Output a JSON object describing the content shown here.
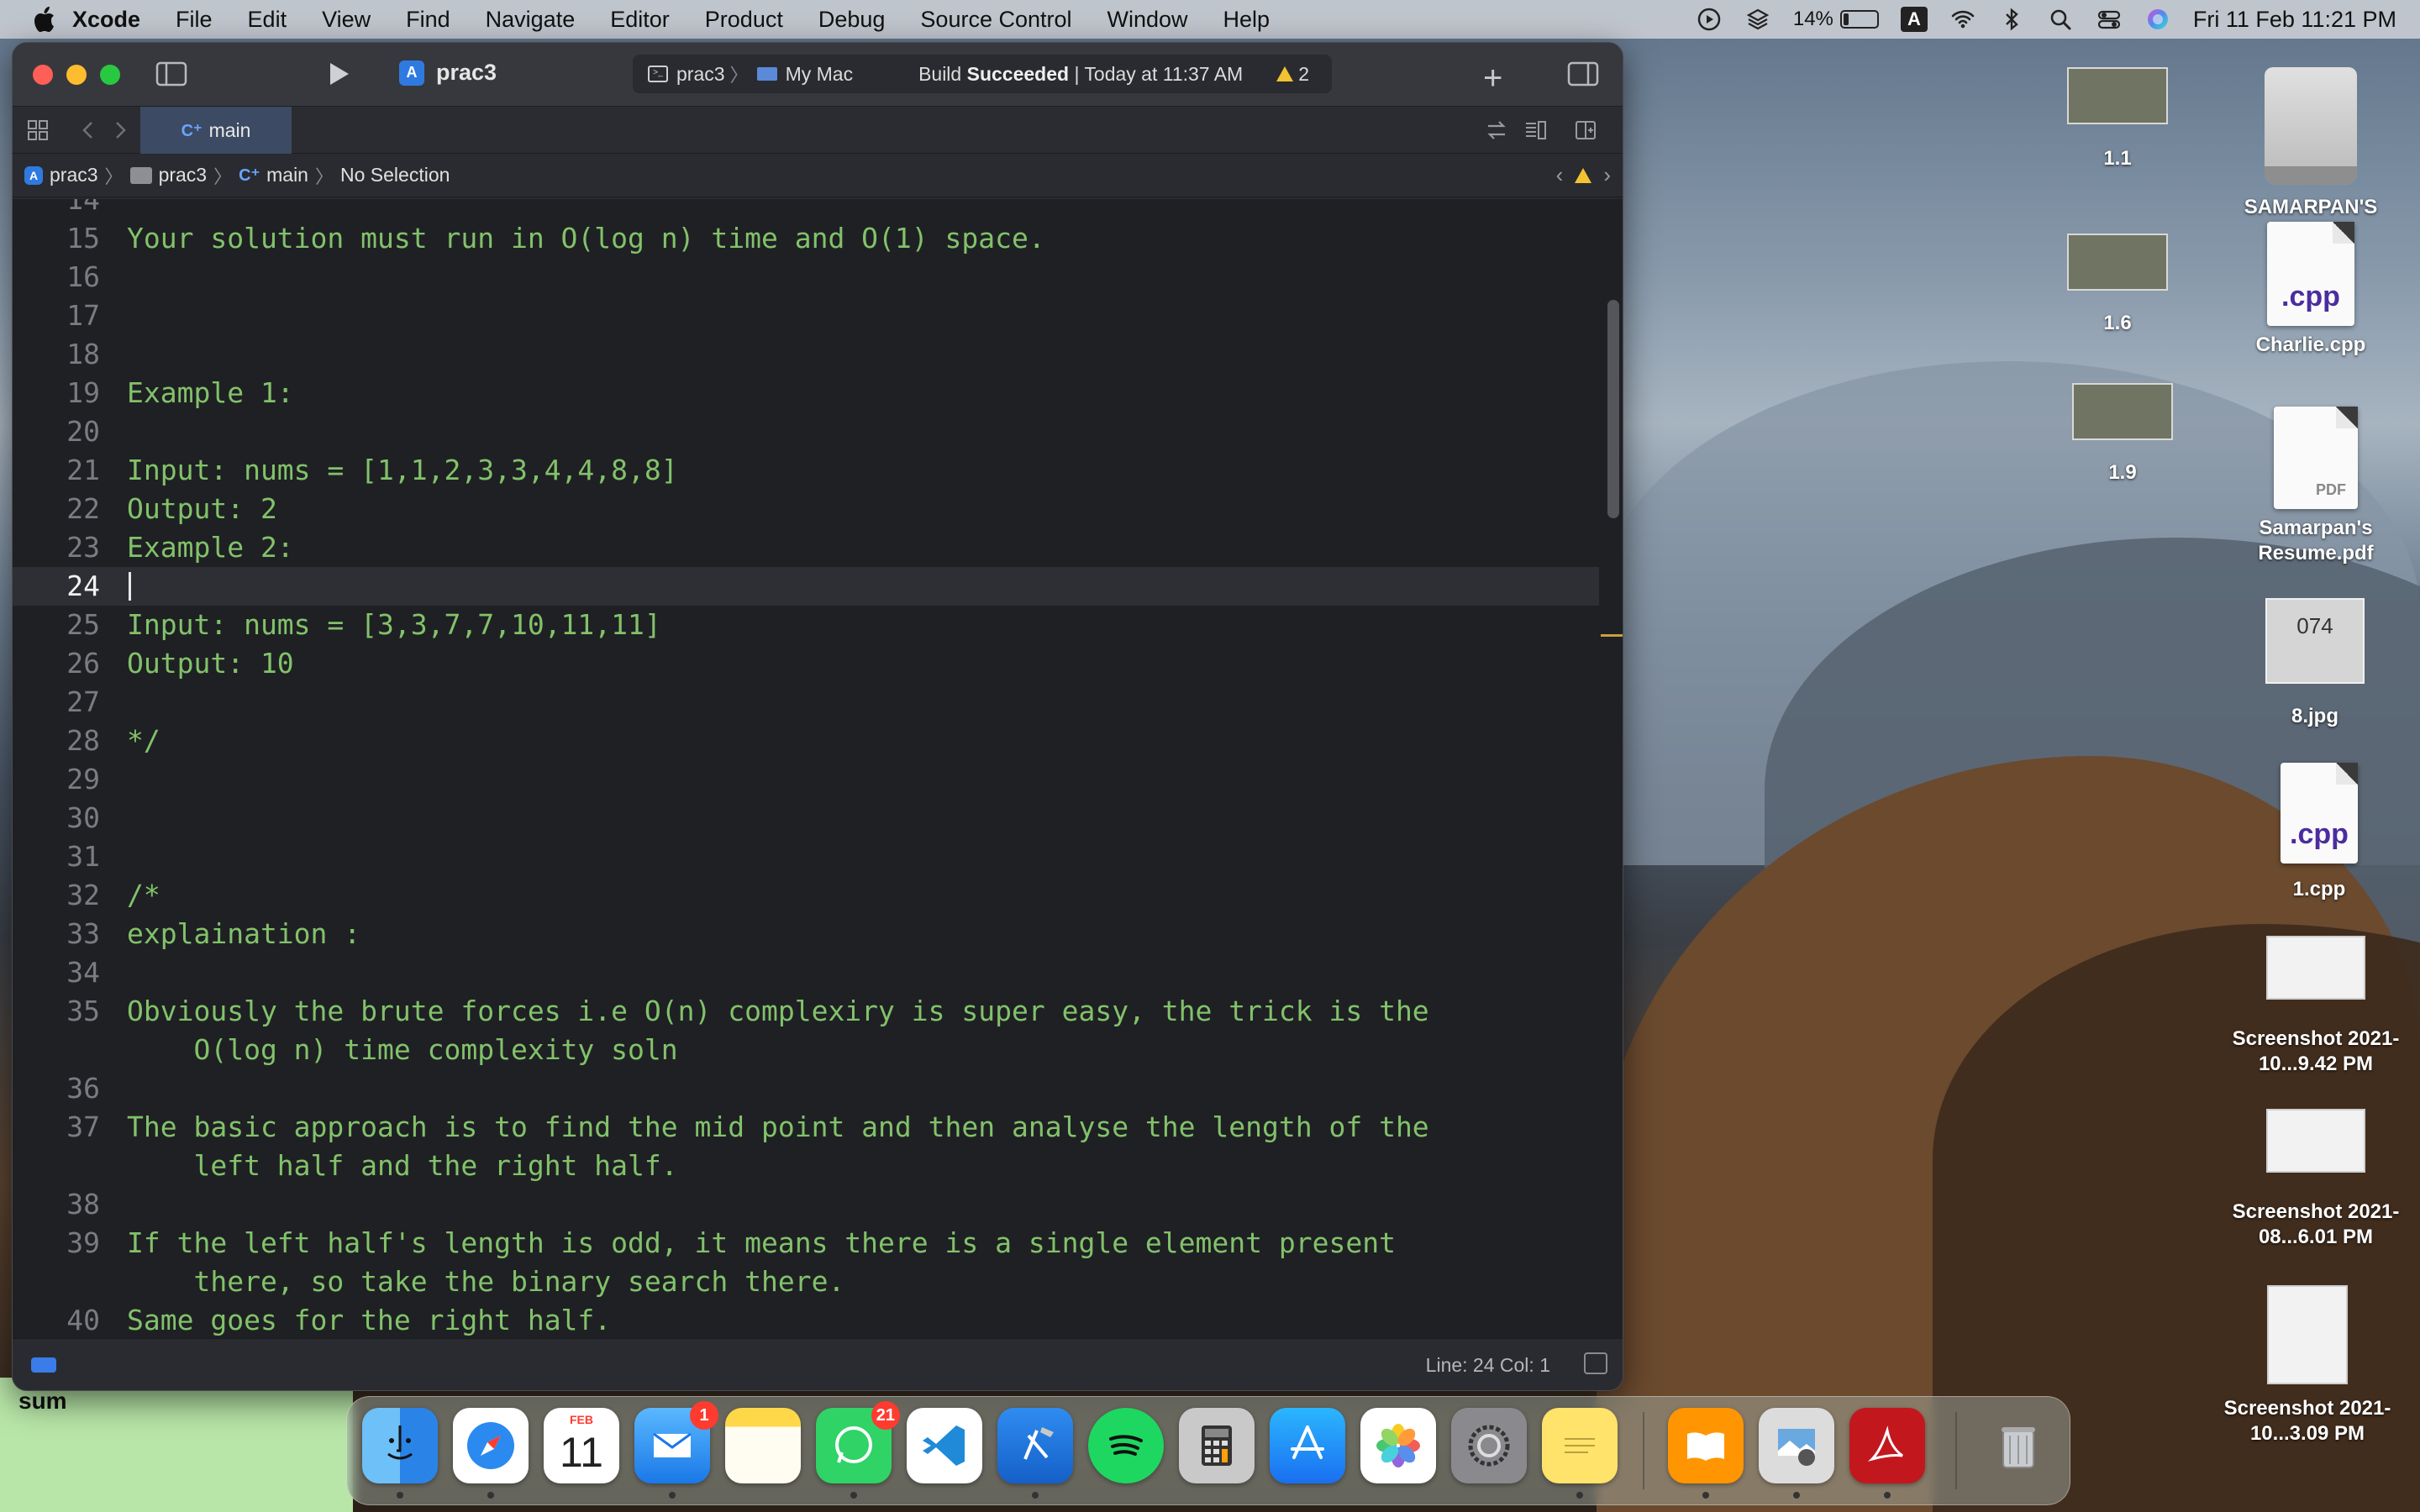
{
  "menubar": {
    "app_name": "Xcode",
    "items": [
      "File",
      "Edit",
      "View",
      "Find",
      "Navigate",
      "Editor",
      "Product",
      "Debug",
      "Source Control",
      "Window",
      "Help"
    ],
    "battery": "14%",
    "input_source": "A",
    "clock": "Fri 11 Feb  11:21 PM"
  },
  "window": {
    "project": "prac3",
    "scheme": "prac3",
    "destination": "My Mac",
    "build_status_prefix": "Build ",
    "build_status_word": "Succeeded",
    "build_status_time": " | Today at 11:37 AM",
    "warnings": "2",
    "tab": "main",
    "breadcrumb": [
      "prac3",
      "prac3",
      "main",
      "No Selection"
    ],
    "status_line": "Line: 24  Col: 1"
  },
  "code_lines": [
    {
      "n": "14",
      "t": ""
    },
    {
      "n": "15",
      "t": "Your solution must run in O(log n) time and O(1) space."
    },
    {
      "n": "16",
      "t": ""
    },
    {
      "n": "17",
      "t": ""
    },
    {
      "n": "18",
      "t": ""
    },
    {
      "n": "19",
      "t": "Example 1:"
    },
    {
      "n": "20",
      "t": ""
    },
    {
      "n": "21",
      "t": "Input: nums = [1,1,2,3,3,4,4,8,8]"
    },
    {
      "n": "22",
      "t": "Output: 2"
    },
    {
      "n": "23",
      "t": "Example 2:"
    },
    {
      "n": "24",
      "t": ""
    },
    {
      "n": "25",
      "t": "Input: nums = [3,3,7,7,10,11,11]"
    },
    {
      "n": "26",
      "t": "Output: 10"
    },
    {
      "n": "27",
      "t": ""
    },
    {
      "n": "28",
      "t": "*/"
    },
    {
      "n": "29",
      "t": ""
    },
    {
      "n": "30",
      "t": ""
    },
    {
      "n": "31",
      "t": ""
    },
    {
      "n": "32",
      "t": "/*"
    },
    {
      "n": "33",
      "t": "explaination :"
    },
    {
      "n": "34",
      "t": ""
    },
    {
      "n": "35",
      "t": "Obviously the brute forces i.e O(n) complexiry is super easy, the trick is the"
    },
    {
      "n": "",
      "t": "    O(log n) time complexity soln"
    },
    {
      "n": "36",
      "t": ""
    },
    {
      "n": "37",
      "t": "The basic approach is to find the mid point and then analyse the length of the"
    },
    {
      "n": "",
      "t": "    left half and the right half."
    },
    {
      "n": "38",
      "t": ""
    },
    {
      "n": "39",
      "t": "If the left half's length is odd, it means there is a single element present"
    },
    {
      "n": "",
      "t": "    there, so take the binary search there."
    },
    {
      "n": "40",
      "t": "Same goes for the right half."
    }
  ],
  "desktop": {
    "icons": [
      {
        "label": "1.1"
      },
      {
        "label": "SAMARPAN'S"
      },
      {
        "label": "1.6"
      },
      {
        "label": "Charlie.cpp",
        "badge": ".cpp"
      },
      {
        "label": "1.9"
      },
      {
        "label": "Samarpan's Resume.pdf",
        "badge": "PDF"
      },
      {
        "label": "8.jpg",
        "badge": "074"
      },
      {
        "label": "1.cpp",
        "badge": ".cpp"
      },
      {
        "label": "Screenshot 2021-10...9.42 PM"
      },
      {
        "label": "Screenshot 2021-08...6.01 PM"
      },
      {
        "label": "Screenshot 2021-10...3.09 PM"
      }
    ],
    "partial_window_label": "sum"
  },
  "dock": {
    "apps": [
      {
        "name": "Finder"
      },
      {
        "name": "Safari"
      },
      {
        "name": "Calendar",
        "month": "FEB",
        "day": "11"
      },
      {
        "name": "Mail",
        "badge": "1"
      },
      {
        "name": "Notes"
      },
      {
        "name": "WhatsApp",
        "badge": "21"
      },
      {
        "name": "Visual Studio Code"
      },
      {
        "name": "Xcode"
      },
      {
        "name": "Spotify"
      },
      {
        "name": "Calculator"
      },
      {
        "name": "App Store"
      },
      {
        "name": "Photos"
      },
      {
        "name": "System Preferences"
      },
      {
        "name": "Stickies"
      },
      {
        "name": "Books"
      },
      {
        "name": "Preview"
      },
      {
        "name": "Acrobat"
      },
      {
        "name": "Trash"
      }
    ]
  },
  "colors": {
    "code_text": "#82c26a",
    "editor_bg": "#1f2024",
    "accent": "#3a7ce8"
  }
}
